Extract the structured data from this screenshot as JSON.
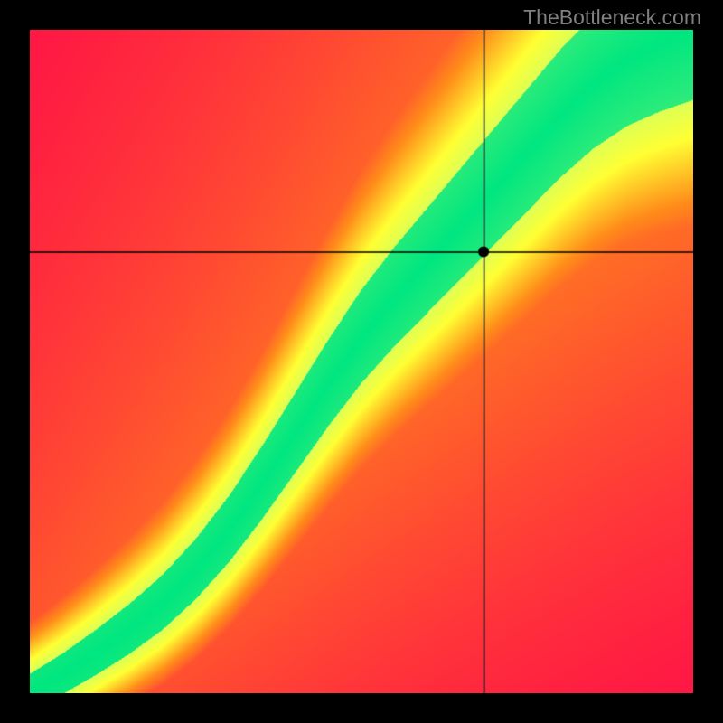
{
  "attribution": "TheBottleneck.com",
  "chart_data": {
    "type": "heatmap",
    "title": "",
    "xlabel": "",
    "ylabel": "",
    "xlim": [
      0,
      1
    ],
    "ylim": [
      0,
      1
    ],
    "crosshair": {
      "x": 0.685,
      "y": 0.665
    },
    "marker": {
      "x": 0.685,
      "y": 0.665
    },
    "colorscale": [
      {
        "stop": 0.0,
        "color": "#ff1744"
      },
      {
        "stop": 0.35,
        "color": "#ff8c1a"
      },
      {
        "stop": 0.6,
        "color": "#ffff33"
      },
      {
        "stop": 0.82,
        "color": "#ccff66"
      },
      {
        "stop": 1.0,
        "color": "#00e680"
      }
    ],
    "optimal_curve": {
      "x": [
        0.0,
        0.05,
        0.1,
        0.15,
        0.2,
        0.25,
        0.3,
        0.35,
        0.4,
        0.45,
        0.5,
        0.55,
        0.6,
        0.65,
        0.7,
        0.75,
        0.8,
        0.85,
        0.9,
        0.95,
        1.0
      ],
      "y": [
        0.0,
        0.028,
        0.06,
        0.095,
        0.135,
        0.185,
        0.245,
        0.315,
        0.39,
        0.465,
        0.535,
        0.595,
        0.65,
        0.705,
        0.76,
        0.815,
        0.87,
        0.918,
        0.955,
        0.98,
        1.0
      ]
    },
    "band_width_base": 0.05,
    "band_width_top": 0.2
  }
}
